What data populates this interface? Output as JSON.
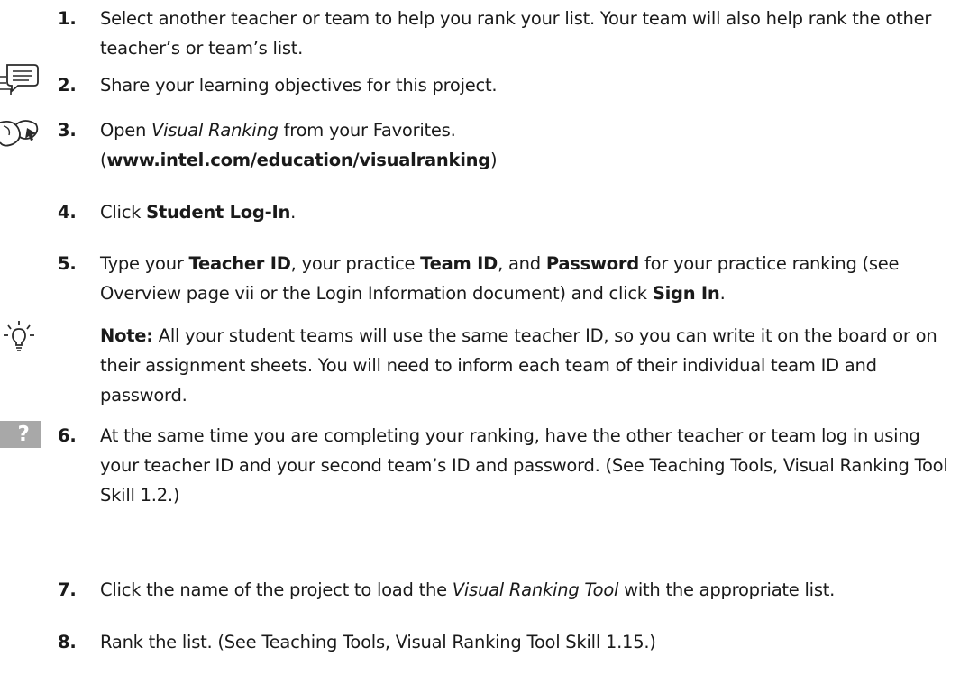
{
  "steps": [
    {
      "number": "1.",
      "text": "Select another teacher or team to help you rank your list. Your team will also help rank the other teacher’s or team’s list.",
      "icon": null
    },
    {
      "number": "2.",
      "text": "Share your learning objectives for this project.",
      "icon": "chat-bubbles-icon"
    },
    {
      "number": "3.",
      "text_parts": [
        "Open ",
        "Visual Ranking",
        " from your Favorites.",
        " (",
        "www.intel.com/education/visualranking",
        ")"
      ],
      "icon": "globe-cursor-icon"
    },
    {
      "number": "4.",
      "text_parts": [
        "Click ",
        "Student Log-In",
        "."
      ],
      "icon": null
    },
    {
      "number": "5.",
      "text_parts": [
        "Type your ",
        "Teacher ID",
        ", your practice ",
        "Team ID",
        ", and ",
        "Password",
        " for your practice ranking (see Overview page vii or the Login Information document) and click ",
        "Sign In",
        "."
      ],
      "icon": null
    },
    {
      "number": "",
      "text_parts": [
        "Note:",
        " All your student teams will use the same teacher ID, so you can write it on the board or on their assignment sheets. You will need to inform each team of their individual team ID and password."
      ],
      "icon": "lightbulb-icon"
    },
    {
      "number": "6.",
      "text": "At the same time you are completing your ranking, have the other teacher or team log in using your teacher ID and your second team’s ID and password. (See Teaching Tools, Visual Ranking Tool Skill 1.2.)",
      "icon": "question-mark-icon",
      "icon_label": "?"
    },
    {
      "number": "7.",
      "text_parts": [
        "Click the name of the project to load the ",
        "Visual Ranking Tool",
        " with the appropriate list."
      ],
      "icon": null
    },
    {
      "number": "8.",
      "text": "Rank the list. (See Teaching Tools, Visual Ranking Tool Skill 1.15.)",
      "icon": null
    }
  ],
  "colors": {
    "text": "#1a1a1a",
    "help_icon_bg": "#a8a8a8",
    "help_icon_fg": "#ffffff",
    "icon_stroke": "#2a2a2a"
  }
}
